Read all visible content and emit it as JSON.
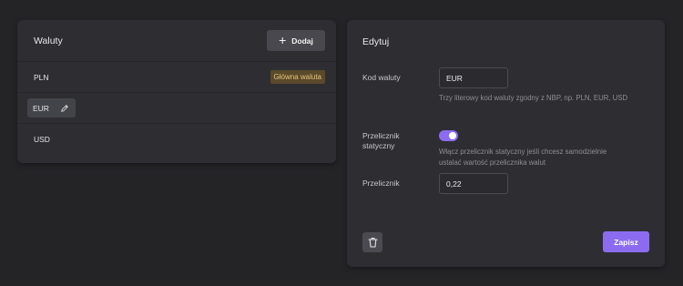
{
  "currencies": {
    "title": "Waluty",
    "add_label": "Dodaj",
    "items": [
      {
        "code": "PLN",
        "badge": "Główna waluta"
      },
      {
        "code": "EUR",
        "selected": true
      },
      {
        "code": "USD"
      }
    ]
  },
  "edit": {
    "title": "Edytuj",
    "code_label": "Kod waluty",
    "code_value": "EUR",
    "code_hint": "Trzy literowy kod waluty zgodny z NBP, np. PLN, EUR, USD",
    "static_label_line1": "Przelicznik",
    "static_label_line2": "statyczny",
    "static_enabled": true,
    "static_hint_line1": "Włącz przelicznik statyczny jeśli chcesz samodzielnie",
    "static_hint_line2": "ustalać wartość przelicznika walut",
    "rate_label": "Przelicznik",
    "rate_value": "0,22",
    "save_label": "Zapisz"
  },
  "colors": {
    "accent": "#8b6cf0",
    "badge_bg": "#5a4a2a",
    "badge_text": "#e8c27a",
    "background": "#242427",
    "card": "#2e2e32"
  }
}
